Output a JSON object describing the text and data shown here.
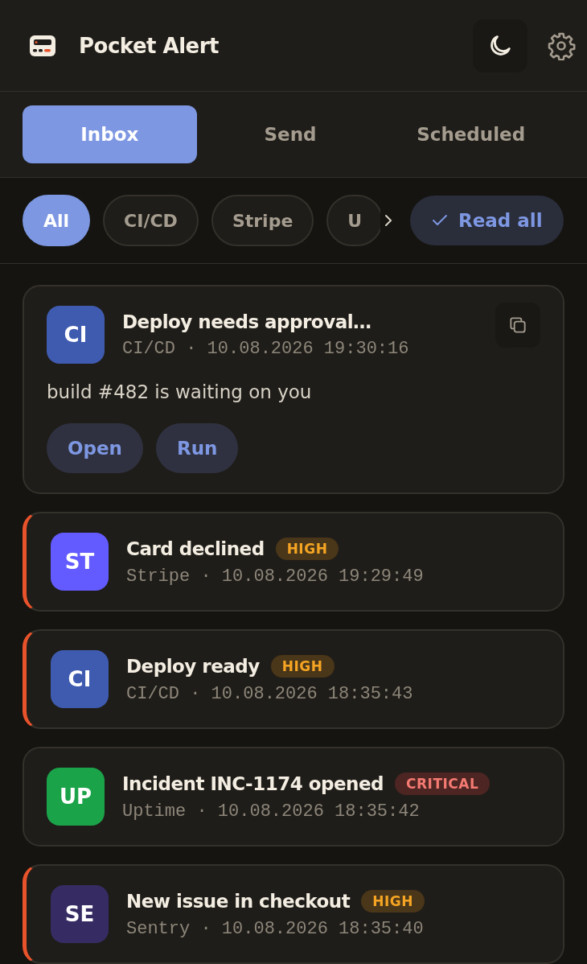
{
  "app": {
    "title": "Pocket Alert"
  },
  "tabs": [
    {
      "label": "Inbox",
      "selected": true
    },
    {
      "label": "Send",
      "selected": false
    },
    {
      "label": "Scheduled",
      "selected": false
    }
  ],
  "filters": [
    {
      "label": "All",
      "selected": true
    },
    {
      "label": "CI/CD",
      "selected": false
    },
    {
      "label": "Stripe",
      "selected": false
    },
    {
      "label": "U",
      "selected": false
    }
  ],
  "read_all": {
    "label": "Read all"
  },
  "notifications": [
    {
      "avatar": "CI",
      "color": "#3f5bb0",
      "title": "Deploy needs approval…",
      "meta": "CI/CD · 10.08.2026 19:30:16",
      "unread": false,
      "expanded": true,
      "body": "build #482 is waiting on you",
      "actions": [
        "Open",
        "Run"
      ]
    },
    {
      "avatar": "ST",
      "color": "#635bff",
      "title": "Card declined",
      "priority": {
        "label": "HIGH",
        "kind": "high"
      },
      "meta": "Stripe · 10.08.2026 19:29:49",
      "unread": true,
      "expanded": false
    },
    {
      "avatar": "CI",
      "color": "#3f5bb0",
      "title": "Deploy ready",
      "priority": {
        "label": "HIGH",
        "kind": "high"
      },
      "meta": "CI/CD · 10.08.2026 18:35:43",
      "unread": true,
      "expanded": false
    },
    {
      "avatar": "UP",
      "color": "#1ba34a",
      "title": "Incident INC-1174 opened",
      "priority": {
        "label": "CRITICAL",
        "kind": "critical"
      },
      "meta": "Uptime · 10.08.2026 18:35:42",
      "unread": false,
      "expanded": false
    },
    {
      "avatar": "SE",
      "color": "#362c63",
      "title": "New issue in checkout",
      "priority": {
        "label": "HIGH",
        "kind": "high"
      },
      "meta": "Sentry · 10.08.2026 18:35:40",
      "unread": true,
      "expanded": false
    }
  ]
}
